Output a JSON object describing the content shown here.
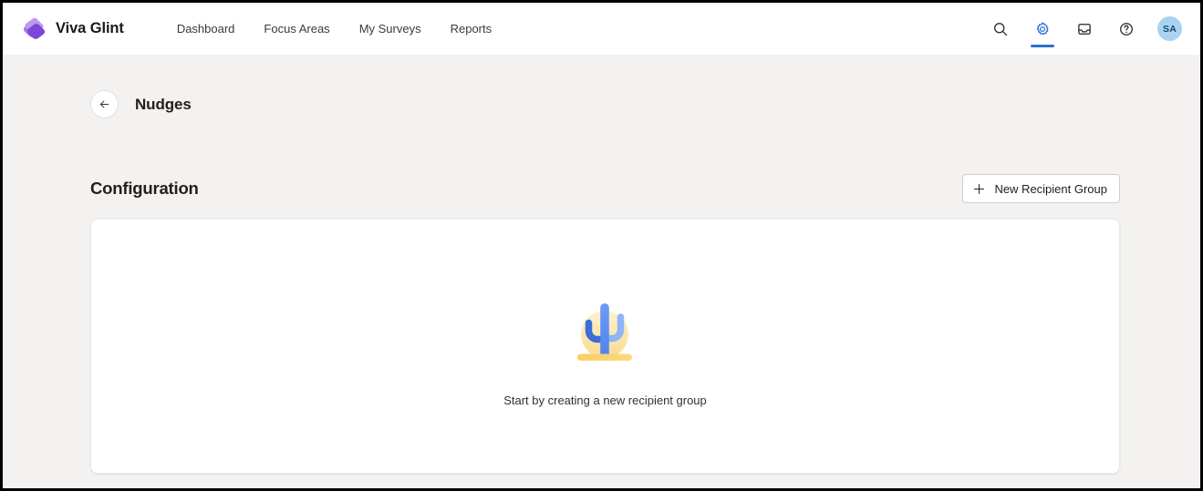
{
  "topbar": {
    "brand": "Viva Glint",
    "logo_icon": "viva-glint-logo-icon",
    "nav": [
      {
        "label": "Dashboard",
        "name": "nav-dashboard"
      },
      {
        "label": "Focus Areas",
        "name": "nav-focus-areas"
      },
      {
        "label": "My Surveys",
        "name": "nav-my-surveys"
      },
      {
        "label": "Reports",
        "name": "nav-reports"
      }
    ],
    "actions": [
      {
        "name": "search-icon",
        "label": "Search"
      },
      {
        "name": "gear-icon",
        "label": "Settings"
      },
      {
        "name": "inbox-icon",
        "label": "Inbox"
      },
      {
        "name": "help-icon",
        "label": "Help"
      }
    ],
    "avatar_initials": "SA",
    "active_action": "gear-icon",
    "accent_color": "#2b6fd4"
  },
  "page": {
    "back_icon": "arrow-left-icon",
    "title": "Nudges"
  },
  "section": {
    "title": "Configuration",
    "new_group_button": "New Recipient Group",
    "new_group_icon": "plus-icon"
  },
  "empty_state": {
    "illustration": "cactus-illustration",
    "message": "Start by creating a new recipient group",
    "colors": {
      "sun": "#fbe8b8",
      "ground": "#f8cf60",
      "cactus_trunk": "#5b8def",
      "cactus_left_arm": "#3a6ed8",
      "cactus_right_arm": "#8fb4f7"
    }
  }
}
